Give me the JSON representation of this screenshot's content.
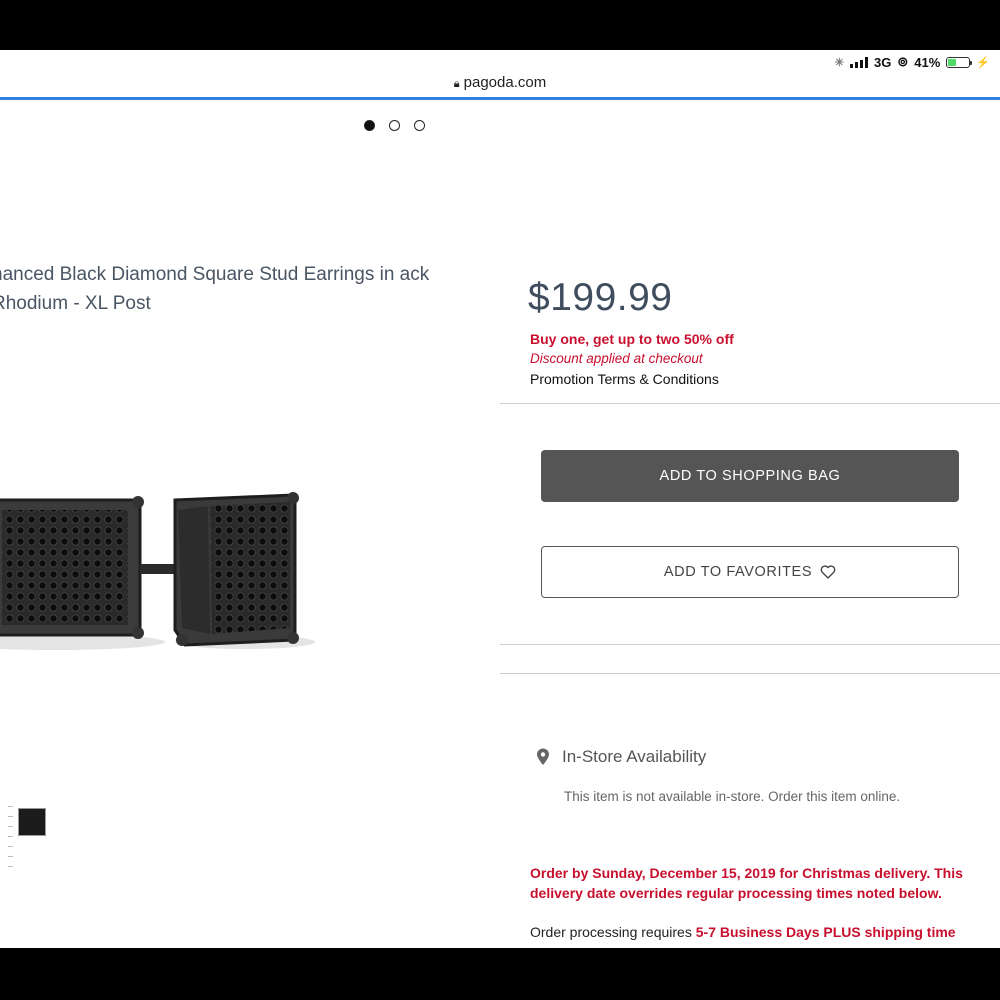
{
  "status": {
    "network": "3G",
    "battery_text": "41%",
    "battery_level": 0.41
  },
  "browser": {
    "url": "pagoda.com",
    "load_progress": 1.0
  },
  "carousel": {
    "count": 3,
    "active_index": 0
  },
  "product": {
    "title": "hanced Black Diamond Square Stud Earrings in ack Rhodium - XL Post",
    "price": "$199.99",
    "promo_headline": "Buy one, get up to two 50% off",
    "promo_subtext": "Discount applied at checkout",
    "promo_terms": "Promotion Terms & Conditions"
  },
  "actions": {
    "add_to_bag_label": "ADD TO SHOPPING BAG",
    "add_to_favorites_label": "ADD TO FAVORITES"
  },
  "availability": {
    "label": "In-Store Availability",
    "note": "This item is not available in-store. Order this item online."
  },
  "shipping": {
    "holiday_notice": "Order by Sunday, December 15, 2019 for Christmas delivery. This delivery date overrides regular processing times noted below.",
    "processing_prefix": "Order processing requires",
    "processing_highlight": "5-7 Business Days PLUS shipping time"
  },
  "colors": {
    "accent_red": "#c8102e",
    "button_dark": "#555555",
    "progress_blue": "#2f7fe0",
    "battery_green": "#4cd964"
  },
  "icons": {
    "lock": "lock-icon",
    "heart": "heart-icon",
    "pin": "location-pin-icon"
  }
}
